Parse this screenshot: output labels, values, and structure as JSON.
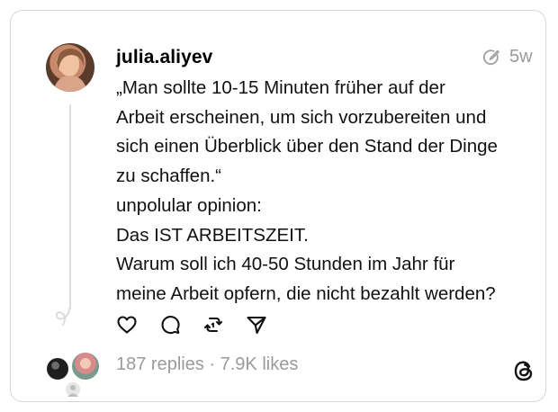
{
  "post": {
    "username": "julia.aliyev",
    "time": "5w",
    "lines": [
      "„Man sollte 10-15 Minuten früher auf der",
      "Arbeit erscheinen, um sich vorzubereiten und",
      "sich einen Überblick über den Stand der Dinge",
      "zu schaffen.“",
      "unpolular opinion:",
      "Das IST ARBEITSZEIT.",
      "Warum soll ich 40-50 Stunden im Jahr für",
      "meine Arbeit opfern, die nicht bezahlt werden?"
    ],
    "stats": "187 replies · 7.9K likes"
  },
  "icons": {
    "time": "edit-circle-icon",
    "like": "heart-icon",
    "reply": "comment-icon",
    "repost": "repost-icon",
    "share": "send-icon",
    "brand": "threads-logo-icon"
  },
  "colors": {
    "muted": "#9b9b9b",
    "border": "#d6d6d6",
    "text": "#111111"
  }
}
